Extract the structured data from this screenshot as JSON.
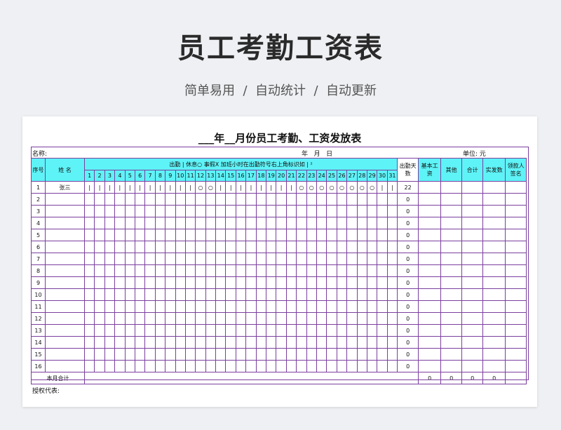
{
  "banner": {
    "title": "员工考勤工资表",
    "subtitle": "简单易用  /  自动统计  /  自动更新"
  },
  "sheet": {
    "title": "___年__月份员工考勤、工资发放表",
    "name_label": "名称:",
    "date_label": "年   月   日",
    "unit_label": "单位: 元",
    "headers": {
      "seq": "序号",
      "name": "姓 名",
      "legend": "出勤 |   休息○        事假X       加班小时在出勤符号右上角标识如 | ²",
      "attendance_days": "出勤天数",
      "base_salary": "基本工资",
      "other": "其他",
      "total": "合计",
      "paid": "实发数",
      "signature": "领款人签名"
    },
    "days": [
      "1",
      "2",
      "3",
      "4",
      "5",
      "6",
      "7",
      "8",
      "9",
      "10",
      "11",
      "12",
      "13",
      "14",
      "15",
      "16",
      "17",
      "18",
      "19",
      "20",
      "21",
      "22",
      "23",
      "24",
      "25",
      "26",
      "27",
      "28",
      "29",
      "30",
      "31"
    ],
    "rows": [
      {
        "no": "1",
        "name": "张三",
        "marks": [
          "|",
          "|",
          "|",
          "|",
          "|",
          "|",
          "|",
          "|",
          "|",
          "|",
          "|",
          "○",
          "○",
          "|",
          "|",
          "|",
          "|",
          "|",
          "|",
          "|",
          "|",
          "○",
          "○",
          "○",
          "○",
          "○",
          "○",
          "○",
          "○",
          "|",
          "|"
        ],
        "days_count": "22"
      },
      {
        "no": "2",
        "name": "",
        "marks": [],
        "days_count": "0"
      },
      {
        "no": "3",
        "name": "",
        "marks": [],
        "days_count": "0"
      },
      {
        "no": "4",
        "name": "",
        "marks": [],
        "days_count": "0"
      },
      {
        "no": "5",
        "name": "",
        "marks": [],
        "days_count": "0"
      },
      {
        "no": "6",
        "name": "",
        "marks": [],
        "days_count": "0"
      },
      {
        "no": "7",
        "name": "",
        "marks": [],
        "days_count": "0"
      },
      {
        "no": "8",
        "name": "",
        "marks": [],
        "days_count": "0"
      },
      {
        "no": "9",
        "name": "",
        "marks": [],
        "days_count": "0"
      },
      {
        "no": "10",
        "name": "",
        "marks": [],
        "days_count": "0"
      },
      {
        "no": "11",
        "name": "",
        "marks": [],
        "days_count": "0"
      },
      {
        "no": "12",
        "name": "",
        "marks": [],
        "days_count": "0"
      },
      {
        "no": "13",
        "name": "",
        "marks": [],
        "days_count": "0"
      },
      {
        "no": "14",
        "name": "",
        "marks": [],
        "days_count": "0"
      },
      {
        "no": "15",
        "name": "",
        "marks": [],
        "days_count": "0"
      },
      {
        "no": "16",
        "name": "",
        "marks": [],
        "days_count": "0"
      }
    ],
    "totals": {
      "label": "本月合计",
      "base_salary": "0",
      "other": "0",
      "total": "0",
      "paid": "0"
    },
    "footer": "授权代表:"
  }
}
